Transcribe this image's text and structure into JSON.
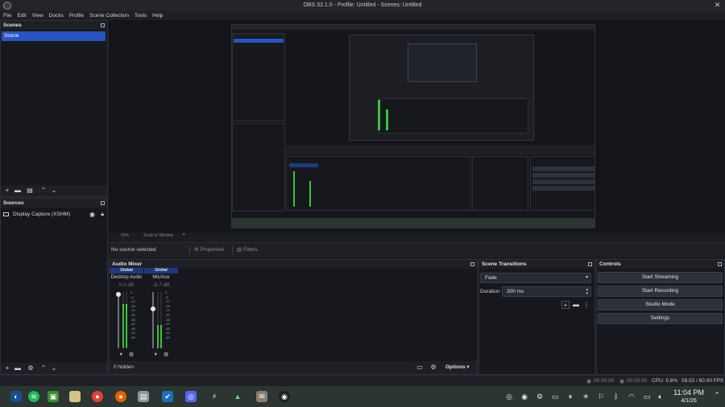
{
  "window": {
    "title": "OBS 32.1.0 - Profile: Untitled - Scenes: Untitled"
  },
  "menu": [
    "File",
    "Edit",
    "View",
    "Docks",
    "Profile",
    "Scene Collection",
    "Tools",
    "Help"
  ],
  "scenes": {
    "title": "Scenes",
    "items": [
      "Scene"
    ],
    "selected": "Scene"
  },
  "sources": {
    "title": "Sources",
    "items": [
      {
        "label": "Display Capture (XSHM)",
        "visible_icon": "eye-icon",
        "lock_icon": "lock-icon"
      }
    ]
  },
  "preview_bar": {
    "zoom": "50%",
    "mode": "Scale to Window"
  },
  "context_bar": {
    "no_source": "No source selected",
    "properties": "Properties",
    "filters": "Filters"
  },
  "audio_mixer": {
    "title": "Audio Mixer",
    "channels": [
      {
        "tag": "Global",
        "name": "Desktop Audio",
        "db": "0.0 dB",
        "level": 0.78,
        "fader": 1.0
      },
      {
        "tag": "Global",
        "name": "Mic/Aux",
        "db": "-8.7 dB",
        "level": 0.42,
        "fader": 0.72
      }
    ],
    "scale": [
      "0",
      "-6",
      "-12",
      "-18",
      "-24",
      "-30",
      "-36",
      "-42",
      "-48",
      "-54",
      "-60"
    ],
    "hidden": "0 hidden",
    "options": "Options"
  },
  "transitions": {
    "title": "Scene Transitions",
    "selected": "Fade",
    "duration_label": "Duration",
    "duration_value": "300 ms"
  },
  "controls": {
    "title": "Controls",
    "buttons": [
      "Start Streaming",
      "Start Recording",
      "Studio Mode",
      "Settings"
    ]
  },
  "status": {
    "rec_time": "00:00:00",
    "stream_time": "00:00:00",
    "cpu": "CPU: 5.6%",
    "fps": "59.02 / 60.00 FPS"
  },
  "taskbar": {
    "apps": [
      "kde-icon",
      "spotify-icon",
      "minecraft-icon",
      "files-icon",
      "chrome-icon",
      "firefox-icon",
      "archive-icon",
      "steam-icon",
      "discord-icon",
      "lutris-icon",
      "plot-icon",
      "gimp-icon",
      "obs-icon"
    ],
    "time": "11:04 PM",
    "date": "4/1/26"
  },
  "colors": {
    "accent": "#2a54c2",
    "meter_green": "#3fbf3f",
    "meter_yellow": "#c8c83a",
    "meter_red": "#c84040",
    "taskbar": "#2c3531"
  }
}
